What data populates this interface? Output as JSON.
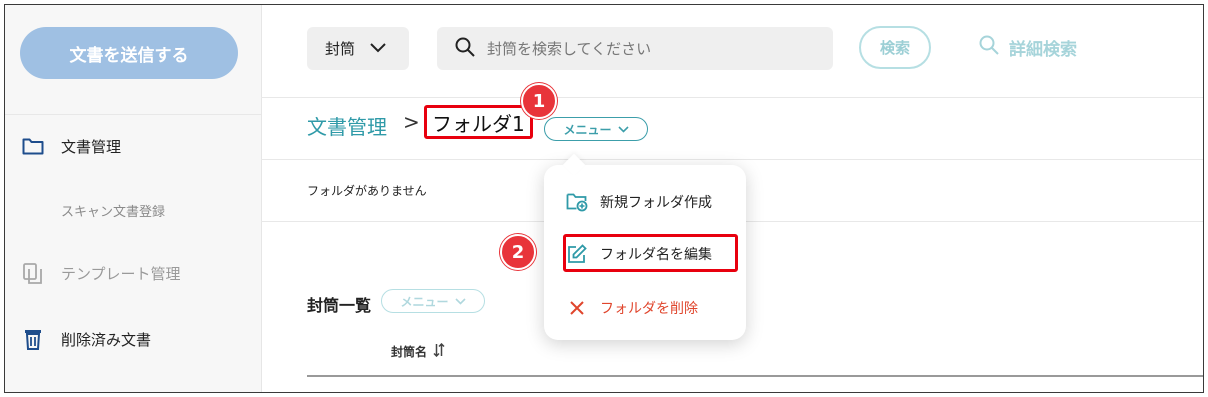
{
  "sidebar": {
    "send_button": "文書を送信する",
    "items": [
      {
        "label": "文書管理",
        "icon": "folder-icon"
      },
      {
        "label": "スキャン文書登録"
      },
      {
        "label": "テンプレート管理",
        "icon": "template-icon"
      },
      {
        "label": "削除済み文書",
        "icon": "trash-icon"
      }
    ]
  },
  "header": {
    "envelope_select": "封筒",
    "search_placeholder": "封筒を検索してください",
    "search_button": "検索",
    "advanced_search": "詳細検索"
  },
  "breadcrumb": {
    "root": "文書管理",
    "separator": ">",
    "current": "フォルダ1",
    "menu_label": "メニュー"
  },
  "folders": {
    "empty_message": "フォルダがありません"
  },
  "envelopes": {
    "title": "封筒一覧",
    "menu_label": "メニュー",
    "column_name": "封筒名"
  },
  "dropdown": {
    "items": [
      {
        "label": "新規フォルダ作成",
        "icon": "folder-add-icon"
      },
      {
        "label": "フォルダ名を編集",
        "icon": "edit-icon"
      },
      {
        "label": "フォルダを削除",
        "icon": "delete-icon"
      }
    ]
  },
  "markers": {
    "one": "1",
    "two": "2"
  },
  "colors": {
    "accent": "#2f9aa8",
    "send_button": "#9fc0e3",
    "highlight": "#e8000e",
    "danger": "#e0452c"
  }
}
